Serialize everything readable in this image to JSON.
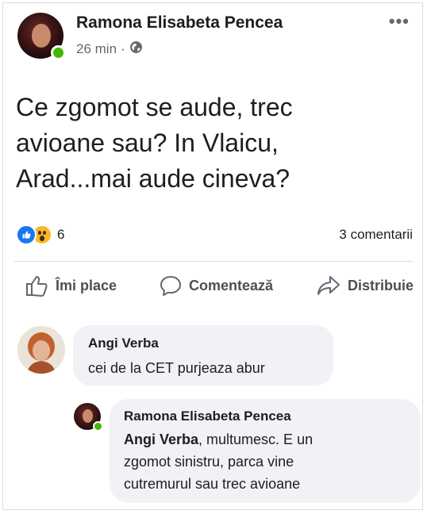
{
  "post": {
    "author": "Ramona Elisabeta Pencea",
    "time": "26 min",
    "separator": "·",
    "text_lines": [
      "Ce zgomot se aude, trec",
      "avioane sau? In Vlaicu,",
      "Arad...mai aude cineva?"
    ],
    "reaction_count": "6",
    "comments_count": "3 comentarii",
    "reactions": [
      "like-icon",
      "wow-icon"
    ],
    "privacy_icon": "globe-icon",
    "menu_icon": "more-icon"
  },
  "actions": {
    "like": "Îmi place",
    "comment": "Comentează",
    "share": "Distribuie"
  },
  "comments": [
    {
      "author": "Angi Verba",
      "text": "cei de la CET purjeaza abur"
    },
    {
      "author": "Ramona Elisabeta Pencea",
      "mention": "Angi Verba",
      "text_lines": [
        ", multumesc.  E un",
        "zgomot sinistru, parca vine",
        "cutremurul  sau trec avioane"
      ]
    }
  ],
  "colors": {
    "brand": "#1877f2",
    "online": "#44b700",
    "bubble": "#f0f2f5",
    "muted": "#65676b"
  }
}
